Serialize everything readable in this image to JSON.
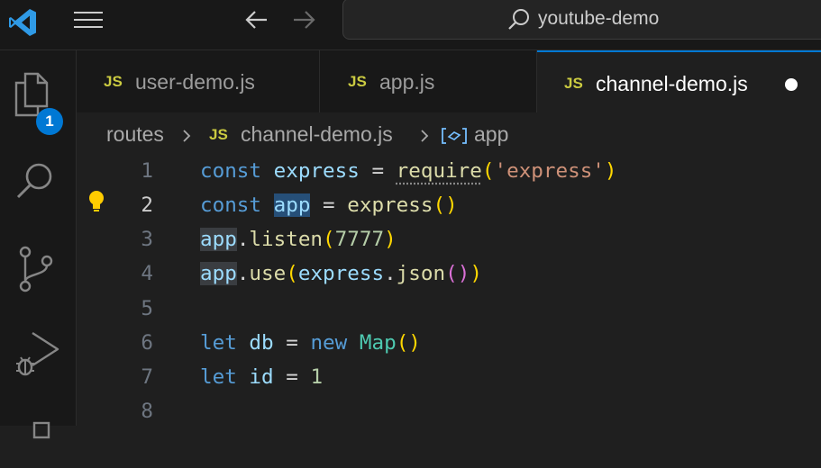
{
  "search": {
    "text": "youtube-demo"
  },
  "activity": {
    "explorer_badge": "1"
  },
  "tabs": [
    {
      "js": "JS",
      "label": "user-demo.js"
    },
    {
      "js": "JS",
      "label": "app.js"
    },
    {
      "js": "JS",
      "label": "channel-demo.js"
    }
  ],
  "breadcrumb": {
    "folder": "routes",
    "js": "JS",
    "file": "channel-demo.js",
    "symbol": "app"
  },
  "code": {
    "line_numbers": [
      "1",
      "2",
      "3",
      "4",
      "5",
      "6",
      "7",
      "8"
    ],
    "l1": {
      "kw": "const",
      "var": "express",
      "eq": " = ",
      "fn": "require",
      "open": "(",
      "str": "'express'",
      "close": ")"
    },
    "l2": {
      "kw": "const",
      "var": "app",
      "eq": " = ",
      "fn": "express",
      "parens": "()"
    },
    "l3": {
      "var": "app",
      "dot": ".",
      "fn": "listen",
      "open": "(",
      "num": "7777",
      "close": ")"
    },
    "l4": {
      "var": "app",
      "dot": ".",
      "fn": "use",
      "open": "(",
      "var2": "express",
      "dot2": ".",
      "fn2": "json",
      "inner": "()",
      "close": ")"
    },
    "l6": {
      "kw": "let",
      "var": "db",
      "eq": " = ",
      "kw2": "new",
      "cls": "Map",
      "parens": "()"
    },
    "l7": {
      "kw": "let",
      "var": "id",
      "eq": " = ",
      "num": "1"
    }
  },
  "colors": {
    "accent": "#0078d4",
    "js_icon": "#cbcb41"
  }
}
